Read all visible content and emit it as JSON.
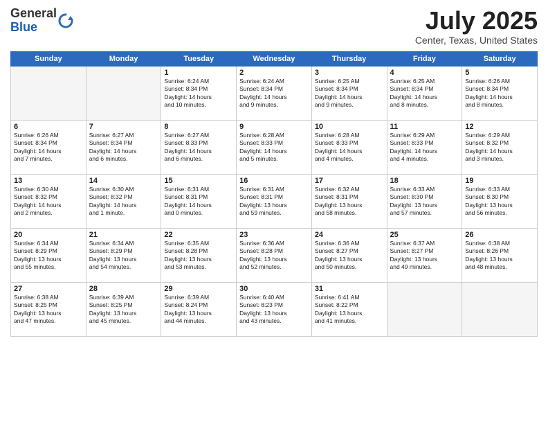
{
  "header": {
    "logo_general": "General",
    "logo_blue": "Blue",
    "month": "July 2025",
    "location": "Center, Texas, United States"
  },
  "weekdays": [
    "Sunday",
    "Monday",
    "Tuesday",
    "Wednesday",
    "Thursday",
    "Friday",
    "Saturday"
  ],
  "weeks": [
    [
      {
        "day": "",
        "empty": true
      },
      {
        "day": "",
        "empty": true
      },
      {
        "day": "1",
        "info": "Sunrise: 6:24 AM\nSunset: 8:34 PM\nDaylight: 14 hours\nand 10 minutes."
      },
      {
        "day": "2",
        "info": "Sunrise: 6:24 AM\nSunset: 8:34 PM\nDaylight: 14 hours\nand 9 minutes."
      },
      {
        "day": "3",
        "info": "Sunrise: 6:25 AM\nSunset: 8:34 PM\nDaylight: 14 hours\nand 9 minutes."
      },
      {
        "day": "4",
        "info": "Sunrise: 6:25 AM\nSunset: 8:34 PM\nDaylight: 14 hours\nand 8 minutes."
      },
      {
        "day": "5",
        "info": "Sunrise: 6:26 AM\nSunset: 8:34 PM\nDaylight: 14 hours\nand 8 minutes."
      }
    ],
    [
      {
        "day": "6",
        "info": "Sunrise: 6:26 AM\nSunset: 8:34 PM\nDaylight: 14 hours\nand 7 minutes."
      },
      {
        "day": "7",
        "info": "Sunrise: 6:27 AM\nSunset: 8:34 PM\nDaylight: 14 hours\nand 6 minutes."
      },
      {
        "day": "8",
        "info": "Sunrise: 6:27 AM\nSunset: 8:33 PM\nDaylight: 14 hours\nand 6 minutes."
      },
      {
        "day": "9",
        "info": "Sunrise: 6:28 AM\nSunset: 8:33 PM\nDaylight: 14 hours\nand 5 minutes."
      },
      {
        "day": "10",
        "info": "Sunrise: 6:28 AM\nSunset: 8:33 PM\nDaylight: 14 hours\nand 4 minutes."
      },
      {
        "day": "11",
        "info": "Sunrise: 6:29 AM\nSunset: 8:33 PM\nDaylight: 14 hours\nand 4 minutes."
      },
      {
        "day": "12",
        "info": "Sunrise: 6:29 AM\nSunset: 8:32 PM\nDaylight: 14 hours\nand 3 minutes."
      }
    ],
    [
      {
        "day": "13",
        "info": "Sunrise: 6:30 AM\nSunset: 8:32 PM\nDaylight: 14 hours\nand 2 minutes."
      },
      {
        "day": "14",
        "info": "Sunrise: 6:30 AM\nSunset: 8:32 PM\nDaylight: 14 hours\nand 1 minute."
      },
      {
        "day": "15",
        "info": "Sunrise: 6:31 AM\nSunset: 8:31 PM\nDaylight: 14 hours\nand 0 minutes."
      },
      {
        "day": "16",
        "info": "Sunrise: 6:31 AM\nSunset: 8:31 PM\nDaylight: 13 hours\nand 59 minutes."
      },
      {
        "day": "17",
        "info": "Sunrise: 6:32 AM\nSunset: 8:31 PM\nDaylight: 13 hours\nand 58 minutes."
      },
      {
        "day": "18",
        "info": "Sunrise: 6:33 AM\nSunset: 8:30 PM\nDaylight: 13 hours\nand 57 minutes."
      },
      {
        "day": "19",
        "info": "Sunrise: 6:33 AM\nSunset: 8:30 PM\nDaylight: 13 hours\nand 56 minutes."
      }
    ],
    [
      {
        "day": "20",
        "info": "Sunrise: 6:34 AM\nSunset: 8:29 PM\nDaylight: 13 hours\nand 55 minutes."
      },
      {
        "day": "21",
        "info": "Sunrise: 6:34 AM\nSunset: 8:29 PM\nDaylight: 13 hours\nand 54 minutes."
      },
      {
        "day": "22",
        "info": "Sunrise: 6:35 AM\nSunset: 8:28 PM\nDaylight: 13 hours\nand 53 minutes."
      },
      {
        "day": "23",
        "info": "Sunrise: 6:36 AM\nSunset: 8:28 PM\nDaylight: 13 hours\nand 52 minutes."
      },
      {
        "day": "24",
        "info": "Sunrise: 6:36 AM\nSunset: 8:27 PM\nDaylight: 13 hours\nand 50 minutes."
      },
      {
        "day": "25",
        "info": "Sunrise: 6:37 AM\nSunset: 8:27 PM\nDaylight: 13 hours\nand 49 minutes."
      },
      {
        "day": "26",
        "info": "Sunrise: 6:38 AM\nSunset: 8:26 PM\nDaylight: 13 hours\nand 48 minutes."
      }
    ],
    [
      {
        "day": "27",
        "info": "Sunrise: 6:38 AM\nSunset: 8:25 PM\nDaylight: 13 hours\nand 47 minutes."
      },
      {
        "day": "28",
        "info": "Sunrise: 6:39 AM\nSunset: 8:25 PM\nDaylight: 13 hours\nand 45 minutes."
      },
      {
        "day": "29",
        "info": "Sunrise: 6:39 AM\nSunset: 8:24 PM\nDaylight: 13 hours\nand 44 minutes."
      },
      {
        "day": "30",
        "info": "Sunrise: 6:40 AM\nSunset: 8:23 PM\nDaylight: 13 hours\nand 43 minutes."
      },
      {
        "day": "31",
        "info": "Sunrise: 6:41 AM\nSunset: 8:22 PM\nDaylight: 13 hours\nand 41 minutes."
      },
      {
        "day": "",
        "empty": true
      },
      {
        "day": "",
        "empty": true
      }
    ]
  ]
}
